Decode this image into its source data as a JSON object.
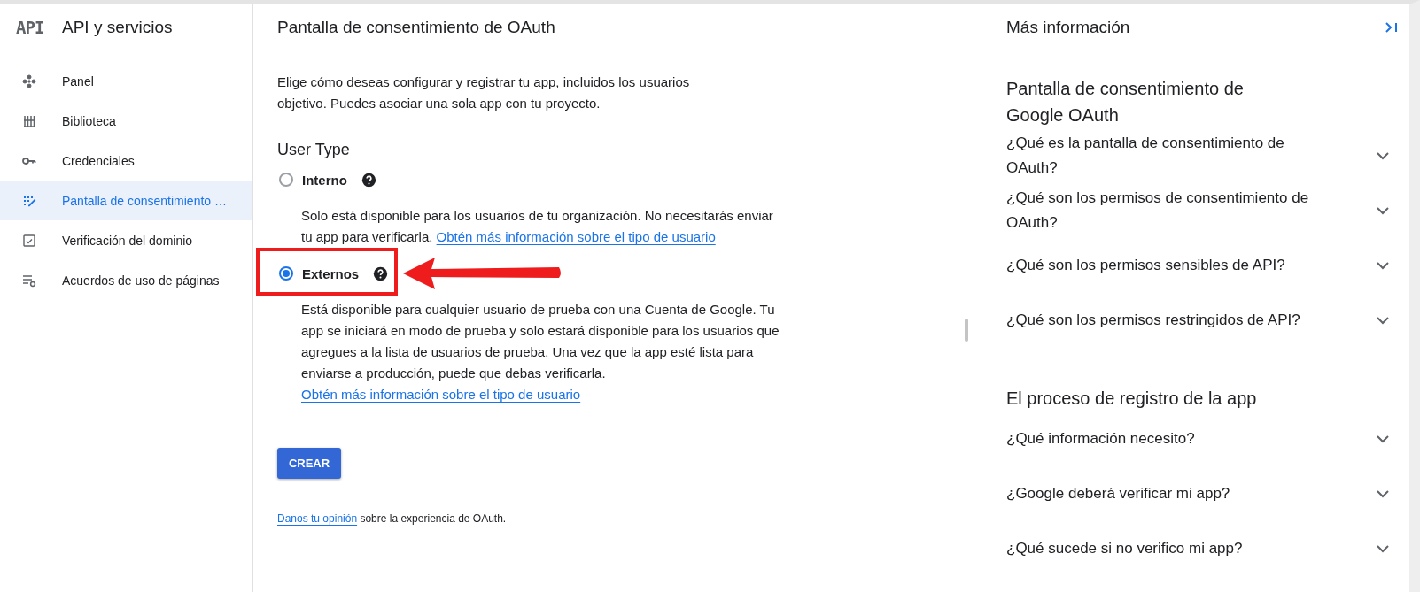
{
  "sidebar": {
    "logo": "API",
    "title": "API y servicios",
    "items": [
      {
        "label": "Panel",
        "kind": "dashboard",
        "selected": false
      },
      {
        "label": "Biblioteca",
        "kind": "library",
        "selected": false
      },
      {
        "label": "Credenciales",
        "kind": "key",
        "selected": false
      },
      {
        "label": "Pantalla de consentimiento …",
        "kind": "consent",
        "selected": true
      },
      {
        "label": "Verificación del dominio",
        "kind": "checkbox",
        "selected": false
      },
      {
        "label": "Acuerdos de uso de páginas",
        "kind": "settings",
        "selected": false
      }
    ]
  },
  "main": {
    "title": "Pantalla de consentimiento de OAuth",
    "intro": "Elige cómo deseas configurar y registrar tu app, incluidos los usuarios objetivo. Puedes asociar una sola app con tu proyecto.",
    "section_title": "User Type",
    "options": [
      {
        "label": "Interno",
        "selected": false,
        "highlighted": false,
        "description": "Solo está disponible para los usuarios de tu organización. No necesitarás enviar tu app para verificarla.",
        "link": "Obtén más información sobre el tipo de usuario"
      },
      {
        "label": "Externos",
        "selected": true,
        "highlighted": true,
        "description": "Está disponible para cualquier usuario de prueba con una Cuenta de Google. Tu app se iniciará en modo de prueba y solo estará disponible para los usuarios que agregues a la lista de usuarios de prueba. Una vez que la app esté lista para enviarse a producción, puede que debas verificarla.",
        "link": "Obtén más información sobre el tipo de usuario"
      }
    ],
    "create_button": "CREAR",
    "feedback_link": "Danos tu opinión",
    "feedback_text": "sobre la experiencia de OAuth."
  },
  "info_panel": {
    "title": "Más información",
    "sections": [
      {
        "heading": "Pantalla de consentimiento de Google OAuth",
        "questions": [
          {
            "text": "¿Qué es la pantalla de consentimiento de OAuth?",
            "expanded": false
          },
          {
            "text": "¿Qué son los permisos de consentimiento de OAuth?",
            "expanded": false
          },
          {
            "text": "¿Qué son los permisos sensibles de API?",
            "expanded": false
          },
          {
            "text": "¿Qué son los permisos restringidos de API?",
            "expanded": false
          }
        ]
      },
      {
        "heading": "El proceso de registro de la app",
        "questions": [
          {
            "text": "¿Qué información necesito?",
            "expanded": false
          },
          {
            "text": "¿Google deberá verificar mi app?",
            "expanded": false
          },
          {
            "text": "¿Qué sucede si no verifico mi app?",
            "expanded": false
          }
        ]
      }
    ]
  }
}
